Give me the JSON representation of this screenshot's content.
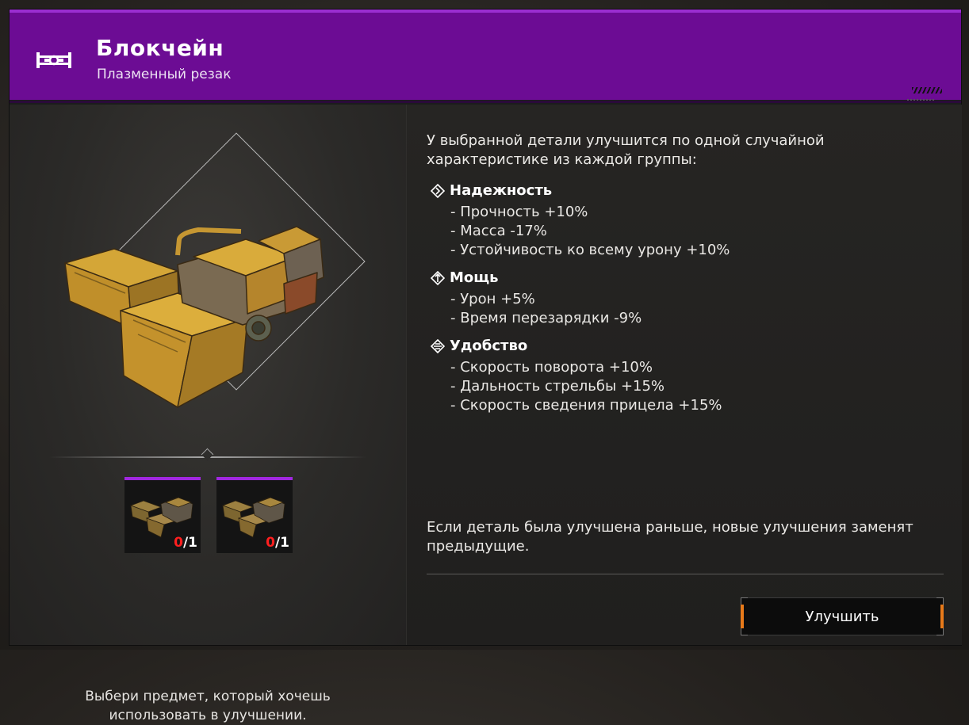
{
  "header": {
    "title": "Блокчейн",
    "subtitle": "Плазменный резак",
    "icon": "weapon-cutter-icon",
    "rarity_color": "#6c0c94"
  },
  "left": {
    "slots": [
      {
        "current": "0",
        "separator": "/",
        "total": "1"
      },
      {
        "current": "0",
        "separator": "/",
        "total": "1"
      }
    ],
    "hint_line1": "Выбери предмет, который хочешь",
    "hint_line2": "использовать в улучшении."
  },
  "right": {
    "intro_line1": "У выбранной детали улучшится по одной случайной",
    "intro_line2": "характеристике из каждой группы:",
    "groups": [
      {
        "title": "Надежность",
        "icon": "reliability-icon",
        "stats": [
          "- Прочность +10%",
          "- Масса -17%",
          "- Устойчивость ко всему урону +10%"
        ]
      },
      {
        "title": "Мощь",
        "icon": "power-icon",
        "stats": [
          "- Урон +5%",
          "- Время перезарядки -9%"
        ]
      },
      {
        "title": "Удобство",
        "icon": "convenience-icon",
        "stats": [
          "- Скорость поворота +10%",
          "- Дальность стрельбы +15%",
          "- Скорость сведения прицела +15%"
        ]
      }
    ],
    "note_line1": "Если деталь была улучшена раньше, новые улучшения заменят",
    "note_line2": "предыдущие.",
    "upgrade_button": "Улучшить",
    "accent_color": "#e77a1a"
  }
}
